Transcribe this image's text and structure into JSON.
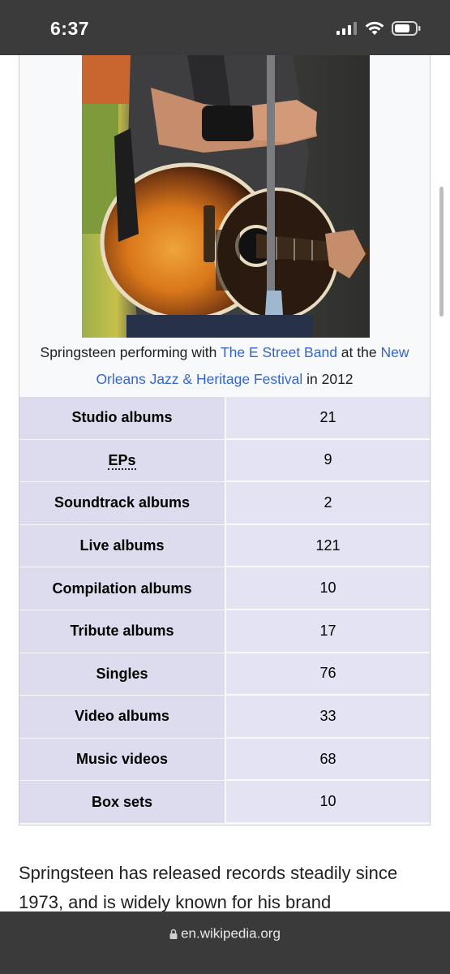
{
  "status": {
    "time": "6:37"
  },
  "caption": {
    "part1": "Springsteen performing with ",
    "link1": "The E Street Band",
    "part2": " at the ",
    "link2": "New Orleans Jazz & Heritage Festival",
    "part3": " in 2012"
  },
  "discography": [
    {
      "label": "Studio albums",
      "value": "21"
    },
    {
      "label": "EPs",
      "value": "9"
    },
    {
      "label": "Soundtrack albums",
      "value": "2"
    },
    {
      "label": "Live albums",
      "value": "121"
    },
    {
      "label": "Compilation albums",
      "value": "10"
    },
    {
      "label": "Tribute albums",
      "value": "17"
    },
    {
      "label": "Singles",
      "value": "76"
    },
    {
      "label": "Video albums",
      "value": "33"
    },
    {
      "label": "Music videos",
      "value": "68"
    },
    {
      "label": "Box sets",
      "value": "10"
    }
  ],
  "article": {
    "text": "Springsteen has released records steadily since 1973, and is widely known for his brand"
  },
  "browser": {
    "url": "en.wikipedia.org"
  },
  "colors": {
    "link": "#3366cc",
    "label_bg": "#dcdcee",
    "value_bg": "#e3e3f3",
    "chrome": "#3a3a3a"
  },
  "icons": [
    "cellular-signal-icon",
    "wifi-icon",
    "battery-icon",
    "lock-icon"
  ]
}
